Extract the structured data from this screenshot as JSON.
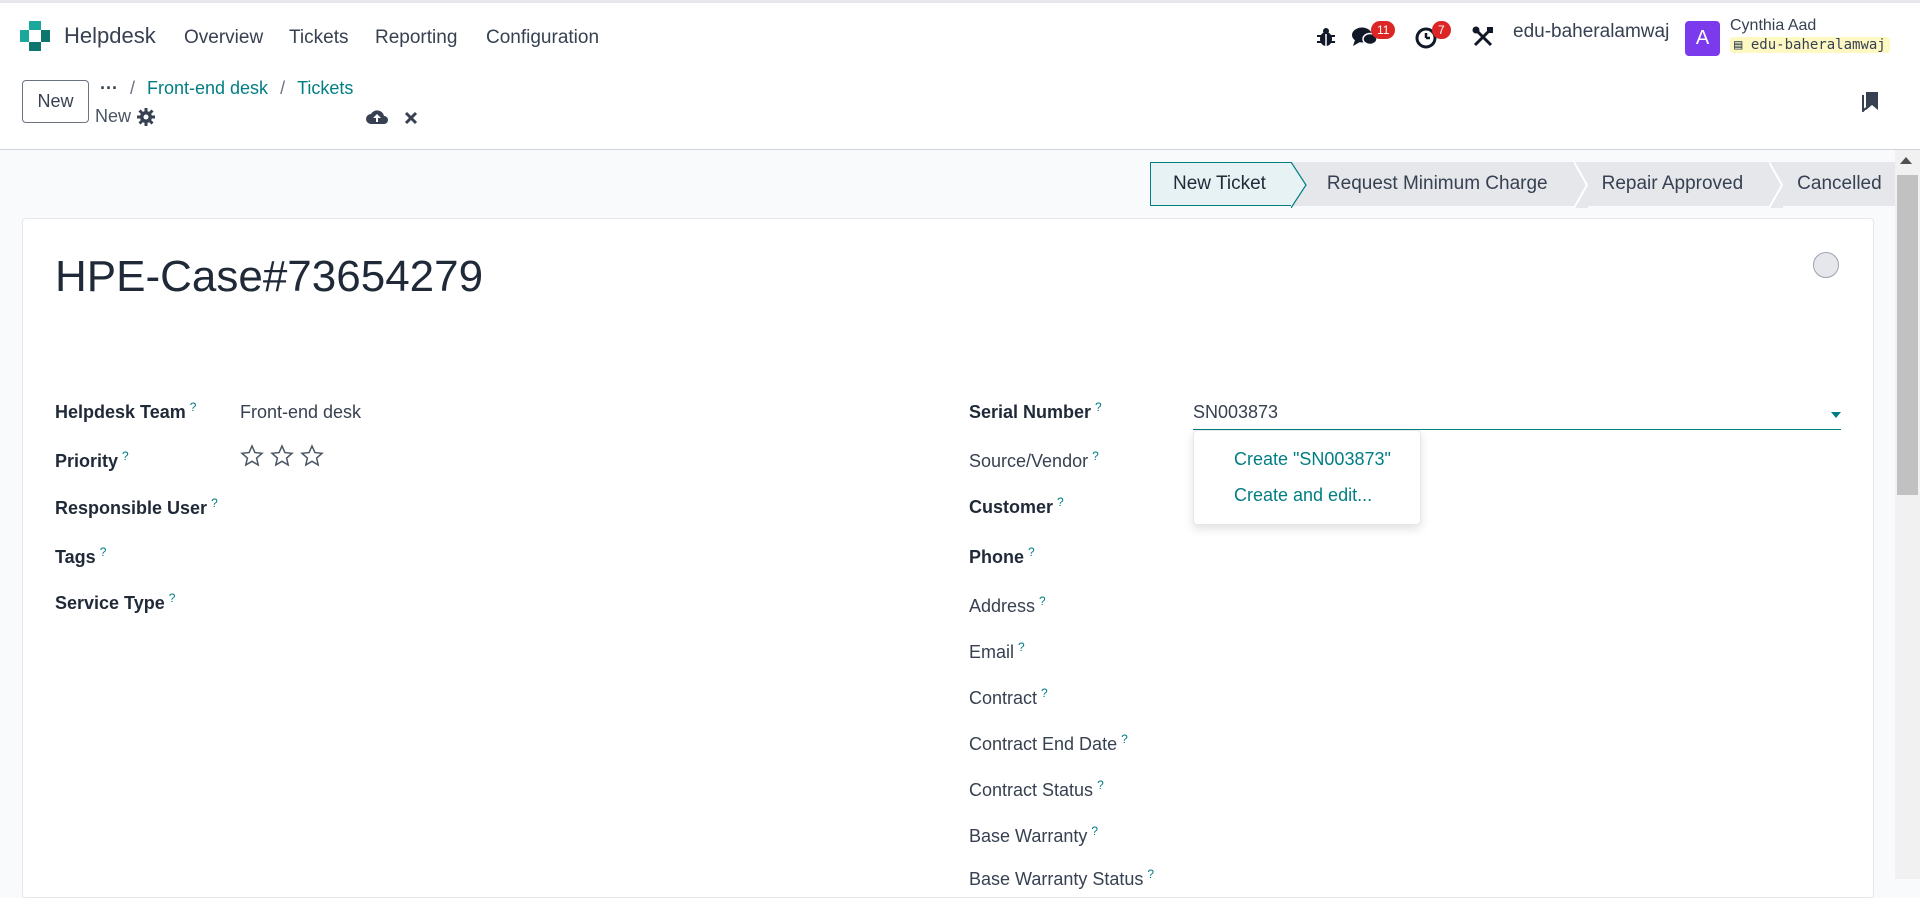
{
  "app": {
    "name": "Helpdesk"
  },
  "menu": [
    "Overview",
    "Tickets",
    "Reporting",
    "Configuration"
  ],
  "systray": {
    "messages_count": "11",
    "activities_count": "7",
    "db_name": "edu-baheralamwaj"
  },
  "user": {
    "avatar_letter": "A",
    "name": "Cynthia Aad",
    "database": "edu-baheralamwaj"
  },
  "control": {
    "new_label": "New",
    "breadcrumbs": [
      "Front-end desk",
      "Tickets"
    ],
    "record_name": "New"
  },
  "statusbar": [
    "New Ticket",
    "Request Minimum Charge",
    "Repair Approved",
    "Cancelled"
  ],
  "ticket": {
    "title": "HPE-Case#73654279",
    "left_fields": [
      {
        "label": "Helpdesk Team",
        "value": "Front-end desk"
      },
      {
        "label": "Priority",
        "value": ""
      },
      {
        "label": "Responsible User",
        "value": ""
      },
      {
        "label": "Tags",
        "value": ""
      },
      {
        "label": "Service Type",
        "value": ""
      }
    ],
    "priority_stars": 0,
    "right_fields": [
      {
        "label": "Serial Number"
      },
      {
        "label": "Source/Vendor"
      },
      {
        "label": "Customer"
      },
      {
        "label": "Phone"
      },
      {
        "label": "Address"
      },
      {
        "label": "Email"
      },
      {
        "label": "Contract"
      },
      {
        "label": "Contract End Date"
      },
      {
        "label": "Contract Status"
      },
      {
        "label": "Base Warranty"
      },
      {
        "label": "Base Warranty Status"
      }
    ],
    "serial_number_value": "SN003873",
    "help_mark": "?"
  },
  "autocomplete": [
    "Create \"SN003873\"",
    "Create and edit..."
  ],
  "colors": {
    "accent": "#017e84",
    "badge": "#dc2626",
    "avatar": "#7c3aed"
  }
}
